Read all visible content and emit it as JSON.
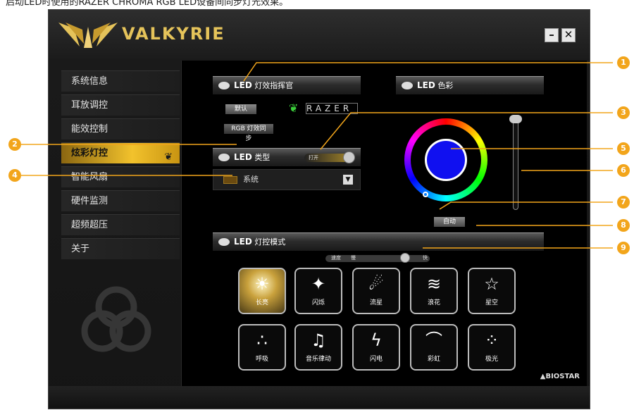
{
  "top_caption": "启动LED时使用的RAZER CHROMA RGB LED设备间同步灯光效果。",
  "app": {
    "brand": "VALKYRIE",
    "min_label": "–",
    "close_label": "✕"
  },
  "sidebar": {
    "items": [
      {
        "label": "系统信息"
      },
      {
        "label": "耳放调控"
      },
      {
        "label": "能效控制"
      },
      {
        "label": "炫彩灯控",
        "active": true
      },
      {
        "label": "智能风扇"
      },
      {
        "label": "硬件监测"
      },
      {
        "label": "超频超压"
      },
      {
        "label": "关于"
      }
    ]
  },
  "panels": {
    "commander_lead": "LED",
    "commander_title": "灯效指挥官",
    "default_chip": "默认",
    "razer_word": "RAZER",
    "sync_chip": "RGB 灯效同步",
    "type_lead": "LED",
    "type_title": "类型",
    "type_toggle_label": "打开",
    "type_dropdown_value": "系统",
    "color_lead": "LED",
    "color_title": "色彩",
    "auto_chip": "自动",
    "mode_lead": "LED",
    "mode_title": "灯控模式",
    "speed_label": "速度",
    "slow_label": "慢",
    "fast_label": "快"
  },
  "color": {
    "selected": "#1010f0",
    "accent": "#f2c22c",
    "callout": "#f2a51b"
  },
  "modes": [
    {
      "label": "长亮",
      "icon": "sun-icon",
      "glyph": "☀",
      "active": true
    },
    {
      "label": "闪烁",
      "icon": "sparkle-icon",
      "glyph": "✦"
    },
    {
      "label": "流星",
      "icon": "meteor-icon",
      "glyph": "☄"
    },
    {
      "label": "浪花",
      "icon": "wave-icon",
      "glyph": "≋"
    },
    {
      "label": "星空",
      "icon": "stars-icon",
      "glyph": "☆"
    },
    {
      "label": "呼吸",
      "icon": "breath-icon",
      "glyph": "∴"
    },
    {
      "label": "音乐律动",
      "icon": "music-icon",
      "glyph": "♫"
    },
    {
      "label": "闪电",
      "icon": "lightning-icon",
      "glyph": "ϟ"
    },
    {
      "label": "彩虹",
      "icon": "rainbow-icon",
      "glyph": "⌒"
    },
    {
      "label": "极光",
      "icon": "aurora-icon",
      "glyph": "⁘"
    }
  ],
  "footer": {
    "brand": "▲BIOSTAR"
  },
  "callouts": [
    "1",
    "2",
    "3",
    "4",
    "5",
    "6",
    "7",
    "8",
    "9"
  ]
}
